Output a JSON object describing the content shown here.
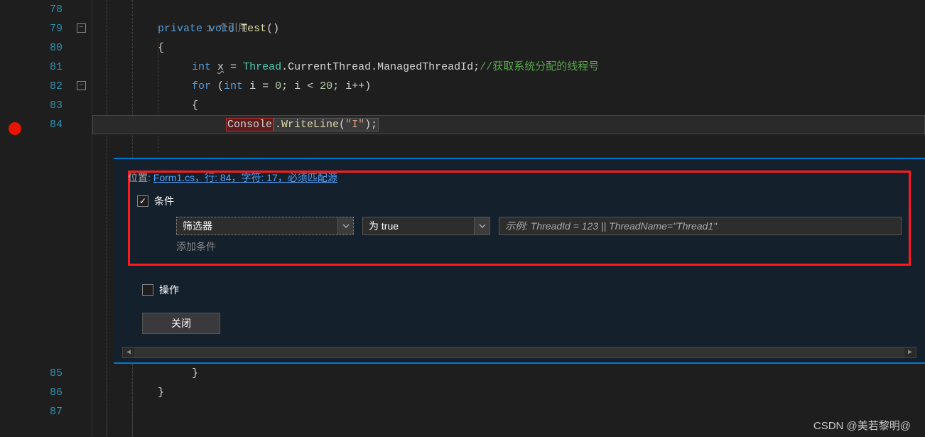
{
  "lines": {
    "l78": "78",
    "l79": "79",
    "l80": "80",
    "l81": "81",
    "l82": "82",
    "l83": "83",
    "l84": "84",
    "l85": "85",
    "l86": "86",
    "l87": "87"
  },
  "code": {
    "codelens": "1 个引用",
    "private": "private",
    "void": "void",
    "test": "Test",
    "parens": "()",
    "obrace": "{",
    "cbrace": "}",
    "int": "int",
    "x": "x",
    "eq": " = ",
    "thread": "Thread",
    "dot": ".",
    "currentthread": "CurrentThread",
    "managedthreadid": "ManagedThreadId",
    "semi": ";",
    "comment1": "//获取系统分配的线程号",
    "for": "for",
    "i": "i",
    "zero": "0",
    "lt": " < ",
    "twenty": "20",
    "ipp": "i++",
    "console": "Console",
    "writeline": "WriteLine",
    "istr": "\"I\"",
    "lp": "(",
    "rp": ")",
    "ssp": "; "
  },
  "panel": {
    "location_label": "位置:",
    "location_link": "Form1.cs，行: 84，字符: 17，必须匹配源",
    "condition_label": "条件",
    "filter_label": "筛选器",
    "true_label": "为 true",
    "placeholder": "示例: ThreadId = 123 || ThreadName=\"Thread1\"",
    "add_condition": "添加条件",
    "actions_label": "操作",
    "close_label": "关闭"
  },
  "watermark": "CSDN @美若黎明@"
}
